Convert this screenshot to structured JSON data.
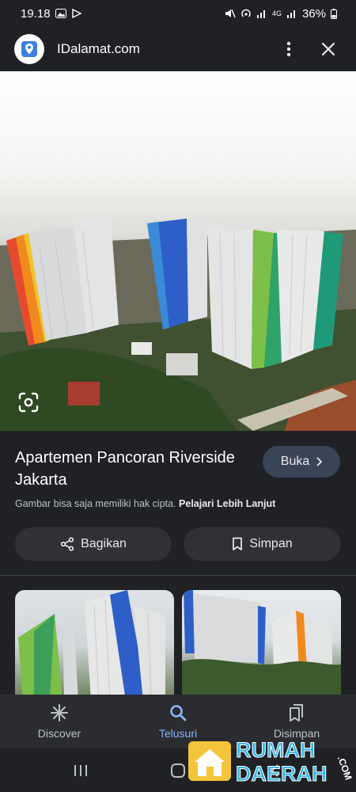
{
  "status": {
    "time": "19.18",
    "network": "4G",
    "battery": "36%"
  },
  "app_bar": {
    "site_name": "IDalamat.com",
    "more_icon": "more-vert-icon",
    "close_icon": "close-icon"
  },
  "result": {
    "title": "Apartemen Pancoran Riverside Jakarta",
    "open_label": "Buka",
    "copyright_text": "Gambar bisa saja memiliki hak cipta.",
    "learn_more": "Pelajari Lebih Lanjut",
    "share_label": "Bagikan",
    "save_label": "Simpan"
  },
  "bottom_nav": {
    "items": [
      {
        "label": "Discover",
        "icon": "asterisk-icon",
        "active": false
      },
      {
        "label": "Telusuri",
        "icon": "search-icon",
        "active": true
      },
      {
        "label": "Disimpan",
        "icon": "bookmarks-icon",
        "active": false
      }
    ]
  },
  "watermark": {
    "line1": "RUMAH",
    "line2": "DAERAH",
    "suffix": ".COM"
  },
  "colors": {
    "background": "#1f2124",
    "accent": "#8ab4f8",
    "open_button": "#394456",
    "pill": "#303134"
  }
}
